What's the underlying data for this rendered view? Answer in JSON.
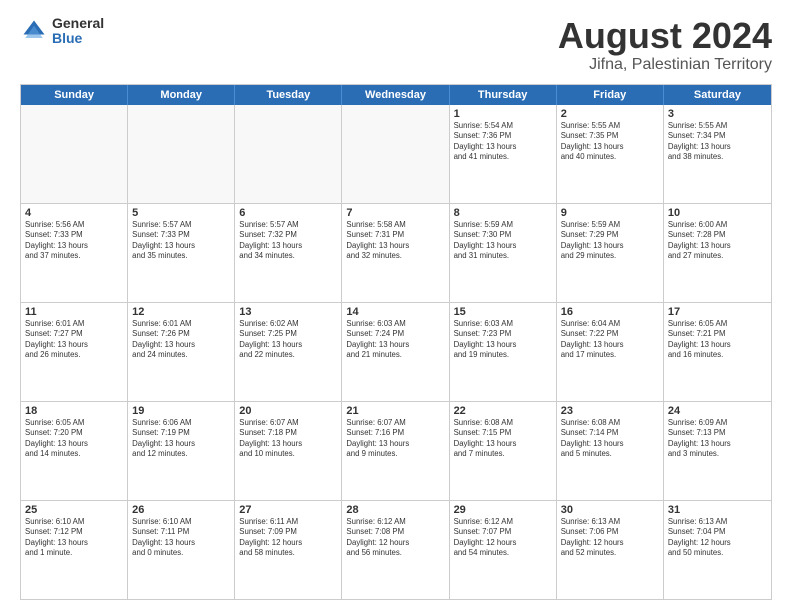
{
  "logo": {
    "general": "General",
    "blue": "Blue"
  },
  "title": {
    "month": "August 2024",
    "location": "Jifna, Palestinian Territory"
  },
  "header": {
    "days": [
      "Sunday",
      "Monday",
      "Tuesday",
      "Wednesday",
      "Thursday",
      "Friday",
      "Saturday"
    ]
  },
  "weeks": [
    [
      {
        "day": "",
        "info": ""
      },
      {
        "day": "",
        "info": ""
      },
      {
        "day": "",
        "info": ""
      },
      {
        "day": "",
        "info": ""
      },
      {
        "day": "1",
        "info": "Sunrise: 5:54 AM\nSunset: 7:36 PM\nDaylight: 13 hours\nand 41 minutes."
      },
      {
        "day": "2",
        "info": "Sunrise: 5:55 AM\nSunset: 7:35 PM\nDaylight: 13 hours\nand 40 minutes."
      },
      {
        "day": "3",
        "info": "Sunrise: 5:55 AM\nSunset: 7:34 PM\nDaylight: 13 hours\nand 38 minutes."
      }
    ],
    [
      {
        "day": "4",
        "info": "Sunrise: 5:56 AM\nSunset: 7:33 PM\nDaylight: 13 hours\nand 37 minutes."
      },
      {
        "day": "5",
        "info": "Sunrise: 5:57 AM\nSunset: 7:33 PM\nDaylight: 13 hours\nand 35 minutes."
      },
      {
        "day": "6",
        "info": "Sunrise: 5:57 AM\nSunset: 7:32 PM\nDaylight: 13 hours\nand 34 minutes."
      },
      {
        "day": "7",
        "info": "Sunrise: 5:58 AM\nSunset: 7:31 PM\nDaylight: 13 hours\nand 32 minutes."
      },
      {
        "day": "8",
        "info": "Sunrise: 5:59 AM\nSunset: 7:30 PM\nDaylight: 13 hours\nand 31 minutes."
      },
      {
        "day": "9",
        "info": "Sunrise: 5:59 AM\nSunset: 7:29 PM\nDaylight: 13 hours\nand 29 minutes."
      },
      {
        "day": "10",
        "info": "Sunrise: 6:00 AM\nSunset: 7:28 PM\nDaylight: 13 hours\nand 27 minutes."
      }
    ],
    [
      {
        "day": "11",
        "info": "Sunrise: 6:01 AM\nSunset: 7:27 PM\nDaylight: 13 hours\nand 26 minutes."
      },
      {
        "day": "12",
        "info": "Sunrise: 6:01 AM\nSunset: 7:26 PM\nDaylight: 13 hours\nand 24 minutes."
      },
      {
        "day": "13",
        "info": "Sunrise: 6:02 AM\nSunset: 7:25 PM\nDaylight: 13 hours\nand 22 minutes."
      },
      {
        "day": "14",
        "info": "Sunrise: 6:03 AM\nSunset: 7:24 PM\nDaylight: 13 hours\nand 21 minutes."
      },
      {
        "day": "15",
        "info": "Sunrise: 6:03 AM\nSunset: 7:23 PM\nDaylight: 13 hours\nand 19 minutes."
      },
      {
        "day": "16",
        "info": "Sunrise: 6:04 AM\nSunset: 7:22 PM\nDaylight: 13 hours\nand 17 minutes."
      },
      {
        "day": "17",
        "info": "Sunrise: 6:05 AM\nSunset: 7:21 PM\nDaylight: 13 hours\nand 16 minutes."
      }
    ],
    [
      {
        "day": "18",
        "info": "Sunrise: 6:05 AM\nSunset: 7:20 PM\nDaylight: 13 hours\nand 14 minutes."
      },
      {
        "day": "19",
        "info": "Sunrise: 6:06 AM\nSunset: 7:19 PM\nDaylight: 13 hours\nand 12 minutes."
      },
      {
        "day": "20",
        "info": "Sunrise: 6:07 AM\nSunset: 7:18 PM\nDaylight: 13 hours\nand 10 minutes."
      },
      {
        "day": "21",
        "info": "Sunrise: 6:07 AM\nSunset: 7:16 PM\nDaylight: 13 hours\nand 9 minutes."
      },
      {
        "day": "22",
        "info": "Sunrise: 6:08 AM\nSunset: 7:15 PM\nDaylight: 13 hours\nand 7 minutes."
      },
      {
        "day": "23",
        "info": "Sunrise: 6:08 AM\nSunset: 7:14 PM\nDaylight: 13 hours\nand 5 minutes."
      },
      {
        "day": "24",
        "info": "Sunrise: 6:09 AM\nSunset: 7:13 PM\nDaylight: 13 hours\nand 3 minutes."
      }
    ],
    [
      {
        "day": "25",
        "info": "Sunrise: 6:10 AM\nSunset: 7:12 PM\nDaylight: 13 hours\nand 1 minute."
      },
      {
        "day": "26",
        "info": "Sunrise: 6:10 AM\nSunset: 7:11 PM\nDaylight: 13 hours\nand 0 minutes."
      },
      {
        "day": "27",
        "info": "Sunrise: 6:11 AM\nSunset: 7:09 PM\nDaylight: 12 hours\nand 58 minutes."
      },
      {
        "day": "28",
        "info": "Sunrise: 6:12 AM\nSunset: 7:08 PM\nDaylight: 12 hours\nand 56 minutes."
      },
      {
        "day": "29",
        "info": "Sunrise: 6:12 AM\nSunset: 7:07 PM\nDaylight: 12 hours\nand 54 minutes."
      },
      {
        "day": "30",
        "info": "Sunrise: 6:13 AM\nSunset: 7:06 PM\nDaylight: 12 hours\nand 52 minutes."
      },
      {
        "day": "31",
        "info": "Sunrise: 6:13 AM\nSunset: 7:04 PM\nDaylight: 12 hours\nand 50 minutes."
      }
    ]
  ]
}
